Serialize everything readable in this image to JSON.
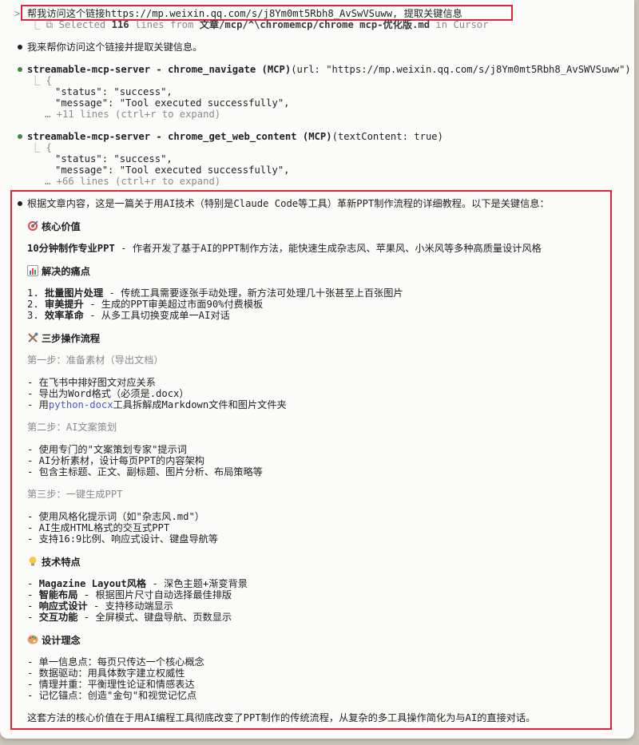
{
  "prompt": {
    "marker": ">",
    "text": "帮我访问这个链接https://mp.weixin.qq.com/s/j8Ym0mt5Rbh8_AvSwVSuww, 提取关键信息",
    "selection_prefix": "⎿ ⧉ Selected ",
    "selection_count": "116",
    "selection_mid": " lines from ",
    "selection_path": "文章/mcp/^\\chromemcp/chrome mcp-优化版.md",
    "selection_suffix": " in Cursor"
  },
  "intro": "我来帮你访问这个链接并提取关键信息。",
  "tool_calls": [
    {
      "name": "streamable-mcp-server - chrome_navigate (MCP)",
      "args": "(url: \"https://mp.weixin.qq.com/s/j8Ym0mt5Rbh8_AvSWVSuww\")",
      "line1": "⎿ {",
      "line2": "\"status\": \"success\",",
      "line3": "\"message\": \"Tool executed successfully\",",
      "more": "… +11 lines (ctrl+r to expand)"
    },
    {
      "name": "streamable-mcp-server - chrome_get_web_content (MCP)",
      "args": "(textContent: true)",
      "line1": "⎿ {",
      "line2": "\"status\": \"success\",",
      "line3": "\"message\": \"Tool executed successfully\",",
      "more": "… +66 lines (ctrl+r to expand)"
    }
  ],
  "answer": {
    "lead": "根据文章内容，这是一篇关于用AI技术（特别是Claude Code等工具）革新PPT制作流程的详细教程。以下是关键信息：",
    "core_heading": "核心价值",
    "core_bold": "10分钟制作专业PPT",
    "core_text": " - 作者开发了基于AI的PPT制作方法，能快速生成杂志风、苹果风、小米风等多种高质量设计风格",
    "pain_heading": "解决的痛点",
    "pain_items": [
      {
        "num": "1. ",
        "bold": "批量图片处理",
        "text": " - 传统工具需要逐张手动处理，新方法可处理几十张甚至上百张图片"
      },
      {
        "num": "2. ",
        "bold": "审美提升",
        "text": " - 生成的PPT审美超过市面90%付费模板"
      },
      {
        "num": "3. ",
        "bold": "效率革命",
        "text": " - 从多工具切换变成单一AI对话"
      }
    ],
    "steps_heading": "三步操作流程",
    "step1_title": "第一步：准备素材（导出文档）",
    "step1_items": [
      "- 在飞书中排好图文对应关系",
      "- 导出为Word格式（必须是.docx）"
    ],
    "step1_item3_prefix": "- 用",
    "step1_item3_code": "python-docx",
    "step1_item3_suffix": "工具拆解成Markdown文件和图片文件夹",
    "step2_title": "第二步：AI文案策划",
    "step2_items": [
      "- 使用专门的\"文案策划专家\"提示词",
      "- AI分析素材，设计每页PPT的内容架构",
      "- 包含主标题、正文、副标题、图片分析、布局策略等"
    ],
    "step3_title": "第三步：一键生成PPT",
    "step3_items": [
      "- 使用风格化提示词（如\"杂志风.md\"）",
      "- AI生成HTML格式的交互式PPT",
      "- 支持16:9比例、响应式设计、键盘导航等"
    ],
    "tech_heading": "技术特点",
    "tech_items": [
      {
        "bold": "Magazine Layout风格",
        "text": " - 深色主题+渐变背景"
      },
      {
        "bold": "智能布局",
        "text": " - 根据图片尺寸自动选择最佳排版"
      },
      {
        "bold": "响应式设计",
        "text": " - 支持移动端显示"
      },
      {
        "bold": "交互功能",
        "text": " - 全屏模式、键盘导航、页数显示"
      }
    ],
    "design_heading": "设计理念",
    "design_items": [
      "- 单一信息点：每页只传达一个核心概念",
      "- 数据驱动：用具体数字建立权威性",
      "- 情理并重：平衡理性论证和情感表达",
      "- 记忆锚点：创造\"金句\"和视觉记忆点"
    ],
    "closing": "这套方法的核心价值在于用AI编程工具彻底改变了PPT制作的传统流程，从复杂的多工具操作简化为与AI的直接对话。"
  },
  "colors": {
    "highlight_box": "#e0223a",
    "success_dot": "#3a8a3a",
    "code_link": "#4b59c8"
  },
  "icons": {
    "core": "target-icon",
    "pain": "chart-icon",
    "steps": "tools-icon",
    "tech": "lightbulb-icon",
    "design": "palette-icon"
  }
}
